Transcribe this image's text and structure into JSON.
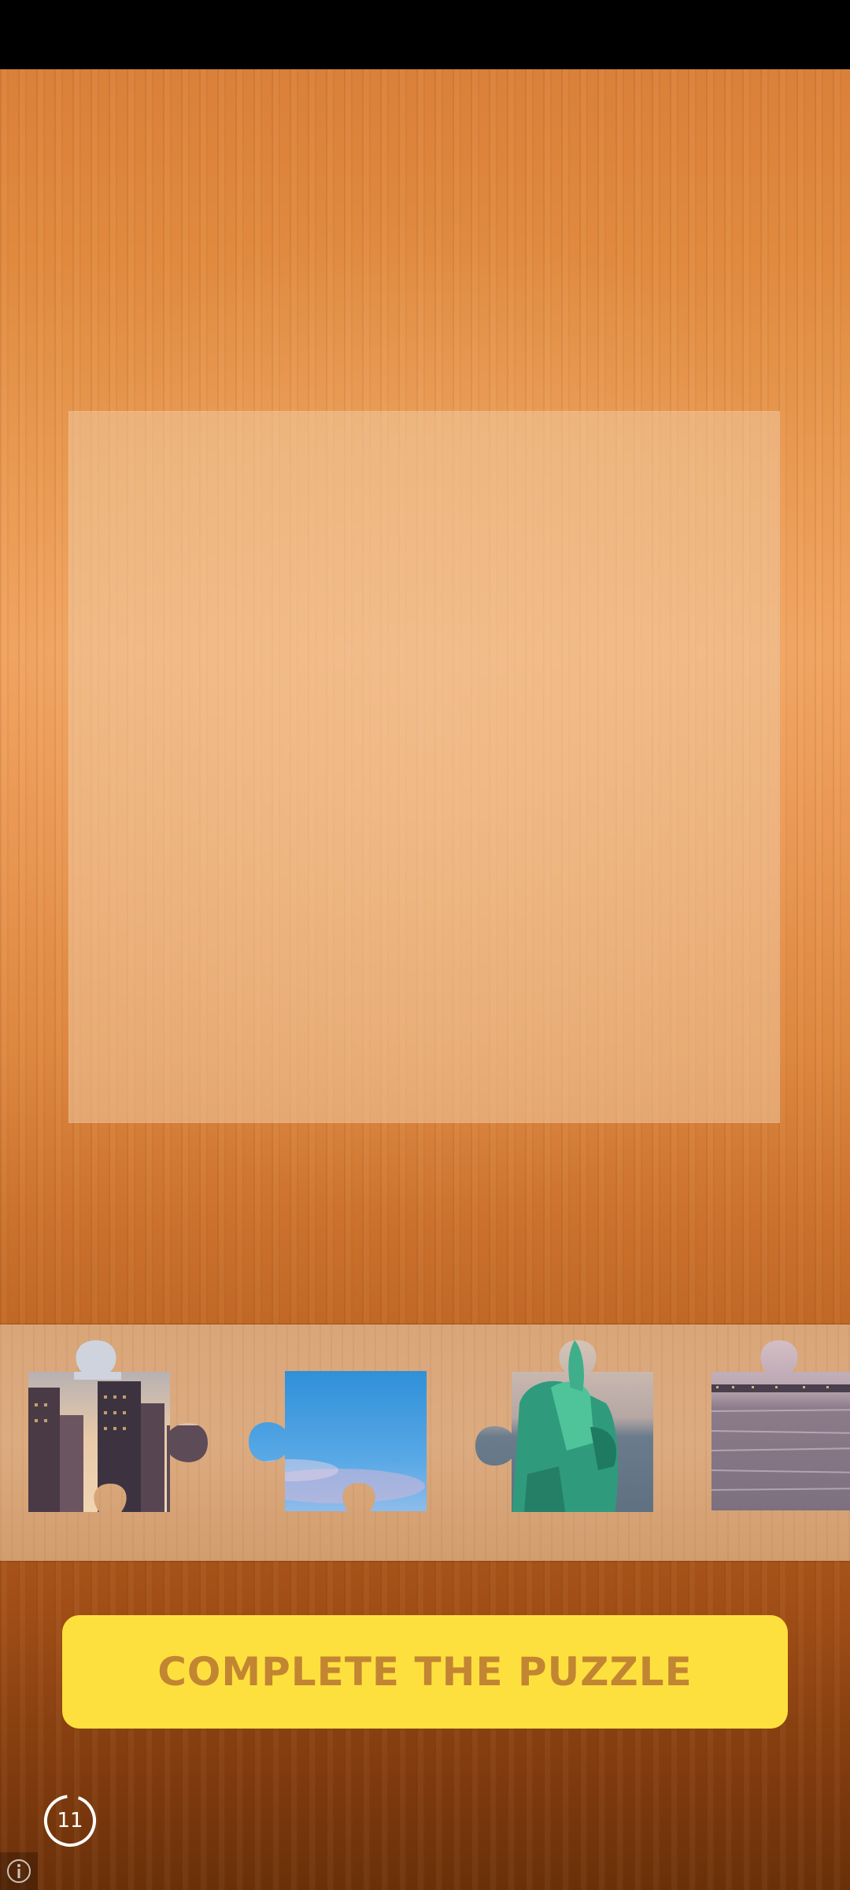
{
  "complete_button": {
    "label": "COMPLETE THE PUZZLE"
  },
  "timer": {
    "value": "11",
    "icon": "countdown-ring-icon"
  },
  "info": {
    "icon": "info-icon"
  },
  "tray": {
    "pieces": [
      {
        "name": "puzzle-piece-skyscrapers",
        "depicts": "city skyscrapers at sunset"
      },
      {
        "name": "puzzle-piece-sky",
        "depicts": "blue sky"
      },
      {
        "name": "puzzle-piece-statue-of-liberty",
        "depicts": "Statue of Liberty"
      },
      {
        "name": "puzzle-piece-water",
        "depicts": "water and skyline"
      }
    ]
  },
  "colors": {
    "button_fill": "#fde03e",
    "button_text": "#c28532",
    "status_bar": "#000000"
  }
}
